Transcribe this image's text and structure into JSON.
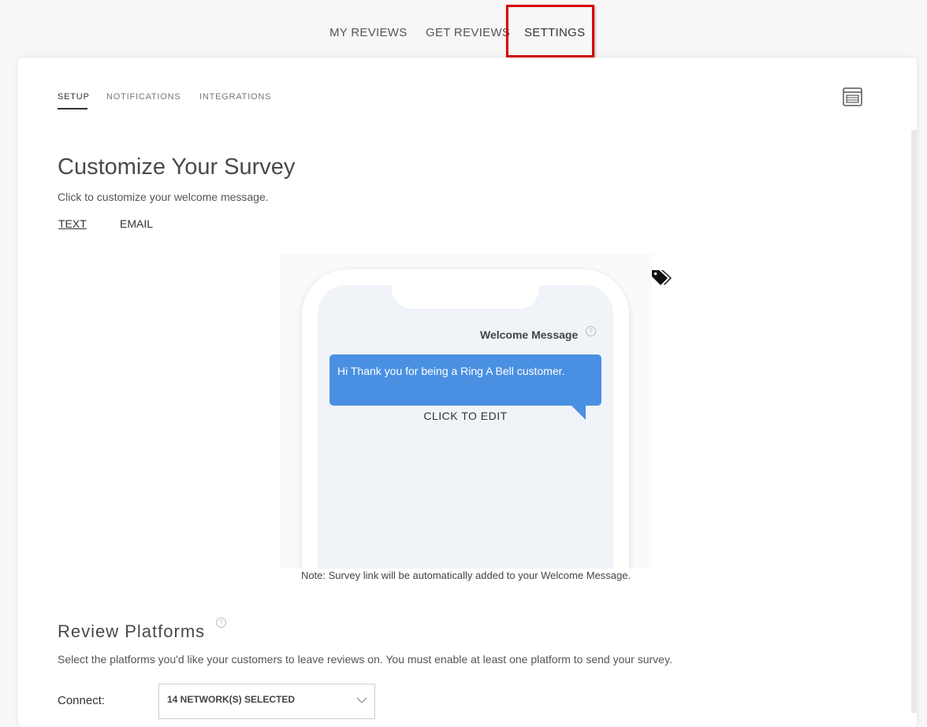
{
  "topnav": {
    "items": [
      "MY REVIEWS",
      "GET REVIEWS",
      "SETTINGS"
    ],
    "active": "SETTINGS",
    "highlight_color": "#d40000"
  },
  "subtabs": {
    "items": [
      "SETUP",
      "NOTIFICATIONS",
      "INTEGRATIONS"
    ],
    "active": "SETUP"
  },
  "icons": {
    "preview": "browser-window-icon",
    "tags": "tags-icon",
    "help": "question-circle-icon",
    "chevron": "chevron-down-icon"
  },
  "customize": {
    "title": "Customize Your Survey",
    "subtitle": "Click to customize your welcome message.",
    "modes": [
      "TEXT",
      "EMAIL"
    ],
    "active_mode": "TEXT"
  },
  "phone": {
    "welcome_label": "Welcome Message",
    "help_glyph": "?",
    "message": "Hi Thank you for being a Ring A Bell customer.",
    "click_to_edit": "CLICK TO EDIT",
    "bubble_color": "#4a90e2"
  },
  "note": "Note: Survey link will be automatically added to your Welcome Message.",
  "platforms": {
    "title": "Review Platforms",
    "description": "Select the platforms you'd like your customers to leave reviews on. You must enable at least one platform to send your survey.",
    "connect_label": "Connect:",
    "selected_value": "14 NETWORK(S) SELECTED"
  }
}
